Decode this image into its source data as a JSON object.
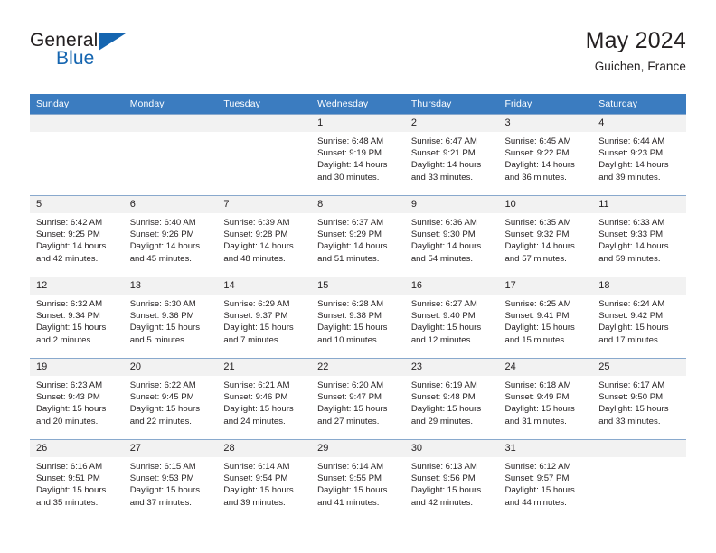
{
  "brand": {
    "name_primary": "General",
    "name_secondary": "Blue",
    "triangle_icon": "triangle-icon",
    "accent_color": "#1565b0"
  },
  "header": {
    "title": "May 2024",
    "subtitle": "Guichen, France"
  },
  "theme": {
    "header_bg": "#3b7cc0",
    "header_text": "#ffffff",
    "daynum_band_bg": "#f2f2f2",
    "row_separator": "#89a9cd",
    "body_text": "#231f20"
  },
  "weekdays": [
    "Sunday",
    "Monday",
    "Tuesday",
    "Wednesday",
    "Thursday",
    "Friday",
    "Saturday"
  ],
  "weeks": [
    [
      {
        "day": "",
        "sunrise": "",
        "sunset": "",
        "daylight_1": "",
        "daylight_2": ""
      },
      {
        "day": "",
        "sunrise": "",
        "sunset": "",
        "daylight_1": "",
        "daylight_2": ""
      },
      {
        "day": "",
        "sunrise": "",
        "sunset": "",
        "daylight_1": "",
        "daylight_2": ""
      },
      {
        "day": "1",
        "sunrise": "Sunrise: 6:48 AM",
        "sunset": "Sunset: 9:19 PM",
        "daylight_1": "Daylight: 14 hours",
        "daylight_2": "and 30 minutes."
      },
      {
        "day": "2",
        "sunrise": "Sunrise: 6:47 AM",
        "sunset": "Sunset: 9:21 PM",
        "daylight_1": "Daylight: 14 hours",
        "daylight_2": "and 33 minutes."
      },
      {
        "day": "3",
        "sunrise": "Sunrise: 6:45 AM",
        "sunset": "Sunset: 9:22 PM",
        "daylight_1": "Daylight: 14 hours",
        "daylight_2": "and 36 minutes."
      },
      {
        "day": "4",
        "sunrise": "Sunrise: 6:44 AM",
        "sunset": "Sunset: 9:23 PM",
        "daylight_1": "Daylight: 14 hours",
        "daylight_2": "and 39 minutes."
      }
    ],
    [
      {
        "day": "5",
        "sunrise": "Sunrise: 6:42 AM",
        "sunset": "Sunset: 9:25 PM",
        "daylight_1": "Daylight: 14 hours",
        "daylight_2": "and 42 minutes."
      },
      {
        "day": "6",
        "sunrise": "Sunrise: 6:40 AM",
        "sunset": "Sunset: 9:26 PM",
        "daylight_1": "Daylight: 14 hours",
        "daylight_2": "and 45 minutes."
      },
      {
        "day": "7",
        "sunrise": "Sunrise: 6:39 AM",
        "sunset": "Sunset: 9:28 PM",
        "daylight_1": "Daylight: 14 hours",
        "daylight_2": "and 48 minutes."
      },
      {
        "day": "8",
        "sunrise": "Sunrise: 6:37 AM",
        "sunset": "Sunset: 9:29 PM",
        "daylight_1": "Daylight: 14 hours",
        "daylight_2": "and 51 minutes."
      },
      {
        "day": "9",
        "sunrise": "Sunrise: 6:36 AM",
        "sunset": "Sunset: 9:30 PM",
        "daylight_1": "Daylight: 14 hours",
        "daylight_2": "and 54 minutes."
      },
      {
        "day": "10",
        "sunrise": "Sunrise: 6:35 AM",
        "sunset": "Sunset: 9:32 PM",
        "daylight_1": "Daylight: 14 hours",
        "daylight_2": "and 57 minutes."
      },
      {
        "day": "11",
        "sunrise": "Sunrise: 6:33 AM",
        "sunset": "Sunset: 9:33 PM",
        "daylight_1": "Daylight: 14 hours",
        "daylight_2": "and 59 minutes."
      }
    ],
    [
      {
        "day": "12",
        "sunrise": "Sunrise: 6:32 AM",
        "sunset": "Sunset: 9:34 PM",
        "daylight_1": "Daylight: 15 hours",
        "daylight_2": "and 2 minutes."
      },
      {
        "day": "13",
        "sunrise": "Sunrise: 6:30 AM",
        "sunset": "Sunset: 9:36 PM",
        "daylight_1": "Daylight: 15 hours",
        "daylight_2": "and 5 minutes."
      },
      {
        "day": "14",
        "sunrise": "Sunrise: 6:29 AM",
        "sunset": "Sunset: 9:37 PM",
        "daylight_1": "Daylight: 15 hours",
        "daylight_2": "and 7 minutes."
      },
      {
        "day": "15",
        "sunrise": "Sunrise: 6:28 AM",
        "sunset": "Sunset: 9:38 PM",
        "daylight_1": "Daylight: 15 hours",
        "daylight_2": "and 10 minutes."
      },
      {
        "day": "16",
        "sunrise": "Sunrise: 6:27 AM",
        "sunset": "Sunset: 9:40 PM",
        "daylight_1": "Daylight: 15 hours",
        "daylight_2": "and 12 minutes."
      },
      {
        "day": "17",
        "sunrise": "Sunrise: 6:25 AM",
        "sunset": "Sunset: 9:41 PM",
        "daylight_1": "Daylight: 15 hours",
        "daylight_2": "and 15 minutes."
      },
      {
        "day": "18",
        "sunrise": "Sunrise: 6:24 AM",
        "sunset": "Sunset: 9:42 PM",
        "daylight_1": "Daylight: 15 hours",
        "daylight_2": "and 17 minutes."
      }
    ],
    [
      {
        "day": "19",
        "sunrise": "Sunrise: 6:23 AM",
        "sunset": "Sunset: 9:43 PM",
        "daylight_1": "Daylight: 15 hours",
        "daylight_2": "and 20 minutes."
      },
      {
        "day": "20",
        "sunrise": "Sunrise: 6:22 AM",
        "sunset": "Sunset: 9:45 PM",
        "daylight_1": "Daylight: 15 hours",
        "daylight_2": "and 22 minutes."
      },
      {
        "day": "21",
        "sunrise": "Sunrise: 6:21 AM",
        "sunset": "Sunset: 9:46 PM",
        "daylight_1": "Daylight: 15 hours",
        "daylight_2": "and 24 minutes."
      },
      {
        "day": "22",
        "sunrise": "Sunrise: 6:20 AM",
        "sunset": "Sunset: 9:47 PM",
        "daylight_1": "Daylight: 15 hours",
        "daylight_2": "and 27 minutes."
      },
      {
        "day": "23",
        "sunrise": "Sunrise: 6:19 AM",
        "sunset": "Sunset: 9:48 PM",
        "daylight_1": "Daylight: 15 hours",
        "daylight_2": "and 29 minutes."
      },
      {
        "day": "24",
        "sunrise": "Sunrise: 6:18 AM",
        "sunset": "Sunset: 9:49 PM",
        "daylight_1": "Daylight: 15 hours",
        "daylight_2": "and 31 minutes."
      },
      {
        "day": "25",
        "sunrise": "Sunrise: 6:17 AM",
        "sunset": "Sunset: 9:50 PM",
        "daylight_1": "Daylight: 15 hours",
        "daylight_2": "and 33 minutes."
      }
    ],
    [
      {
        "day": "26",
        "sunrise": "Sunrise: 6:16 AM",
        "sunset": "Sunset: 9:51 PM",
        "daylight_1": "Daylight: 15 hours",
        "daylight_2": "and 35 minutes."
      },
      {
        "day": "27",
        "sunrise": "Sunrise: 6:15 AM",
        "sunset": "Sunset: 9:53 PM",
        "daylight_1": "Daylight: 15 hours",
        "daylight_2": "and 37 minutes."
      },
      {
        "day": "28",
        "sunrise": "Sunrise: 6:14 AM",
        "sunset": "Sunset: 9:54 PM",
        "daylight_1": "Daylight: 15 hours",
        "daylight_2": "and 39 minutes."
      },
      {
        "day": "29",
        "sunrise": "Sunrise: 6:14 AM",
        "sunset": "Sunset: 9:55 PM",
        "daylight_1": "Daylight: 15 hours",
        "daylight_2": "and 41 minutes."
      },
      {
        "day": "30",
        "sunrise": "Sunrise: 6:13 AM",
        "sunset": "Sunset: 9:56 PM",
        "daylight_1": "Daylight: 15 hours",
        "daylight_2": "and 42 minutes."
      },
      {
        "day": "31",
        "sunrise": "Sunrise: 6:12 AM",
        "sunset": "Sunset: 9:57 PM",
        "daylight_1": "Daylight: 15 hours",
        "daylight_2": "and 44 minutes."
      },
      {
        "day": "",
        "sunrise": "",
        "sunset": "",
        "daylight_1": "",
        "daylight_2": ""
      }
    ]
  ]
}
